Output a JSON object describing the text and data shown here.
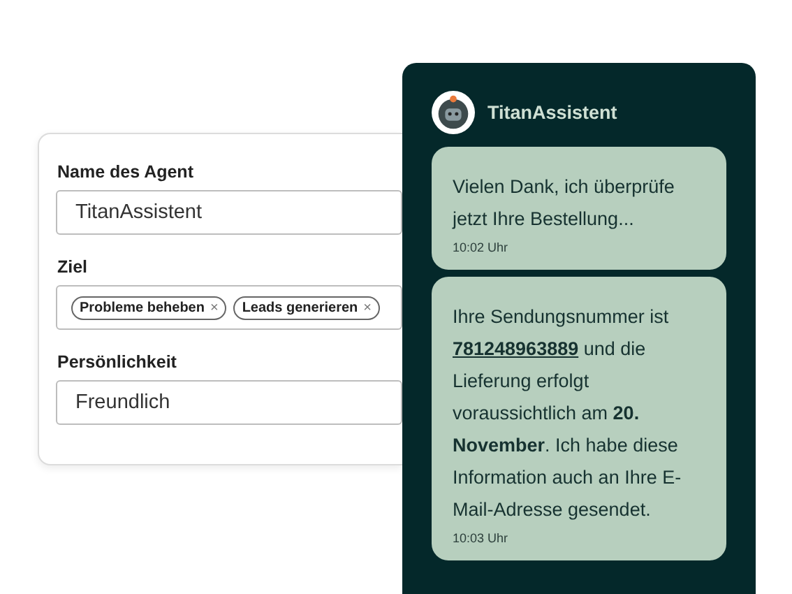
{
  "agent_form": {
    "fields": [
      {
        "label": "Name des Agent",
        "kind": "input",
        "value": "TitanAssistent"
      },
      {
        "label": "Ziel",
        "kind": "tags",
        "tags": [
          {
            "text": "Probleme beheben",
            "remove": "×"
          },
          {
            "text": "Leads generieren",
            "remove": "×"
          }
        ]
      },
      {
        "label": "Persönlichkeit",
        "kind": "input",
        "value": "Freundlich"
      }
    ]
  },
  "chat": {
    "assistant_name": "TitanAssistent",
    "messages": [
      {
        "segments": [
          {
            "kind": "text",
            "text": "Vielen Dank, ich überprüfe jetzt Ihre Bestellung..."
          }
        ],
        "time": "10:02 Uhr"
      },
      {
        "segments": [
          {
            "kind": "text",
            "text": "Ihre Sendungsnummer ist "
          },
          {
            "kind": "link",
            "text": "781248963889"
          },
          {
            "kind": "text",
            "text": " und die Lieferung erfolgt voraussichtlich am **20. November**. Ich habe diese Information auch an Ihre E-Mail-Adresse gesendet."
          }
        ],
        "time": "10:03 Uhr"
      }
    ]
  }
}
